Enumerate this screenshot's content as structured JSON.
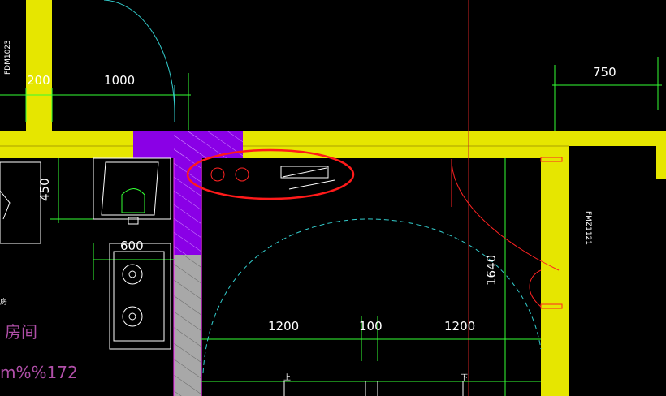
{
  "dimensions": {
    "top_left_wall": "200",
    "top_door_width": "1000",
    "top_right": "750",
    "cabinet_depth": "450",
    "stove_width": "600",
    "door_leaf_left": "1200",
    "door_gap": "100",
    "door_leaf_right": "1200",
    "vertical_1640": "1640"
  },
  "tags": {
    "door_top_left": "FDM1023",
    "door_right": "FMZ1121"
  },
  "labels": {
    "room_name": "房间",
    "room_fragment": "房",
    "area_text": "m%%172",
    "stair_up": "上",
    "stair_down": "下"
  },
  "colors": {
    "wall": "#e6e600",
    "shaft": "#8a00e6",
    "highlight": "#ff1a1a",
    "dimension_line": "#33ff33",
    "arc": "#33cccc",
    "room_text": "#b04fa8"
  }
}
